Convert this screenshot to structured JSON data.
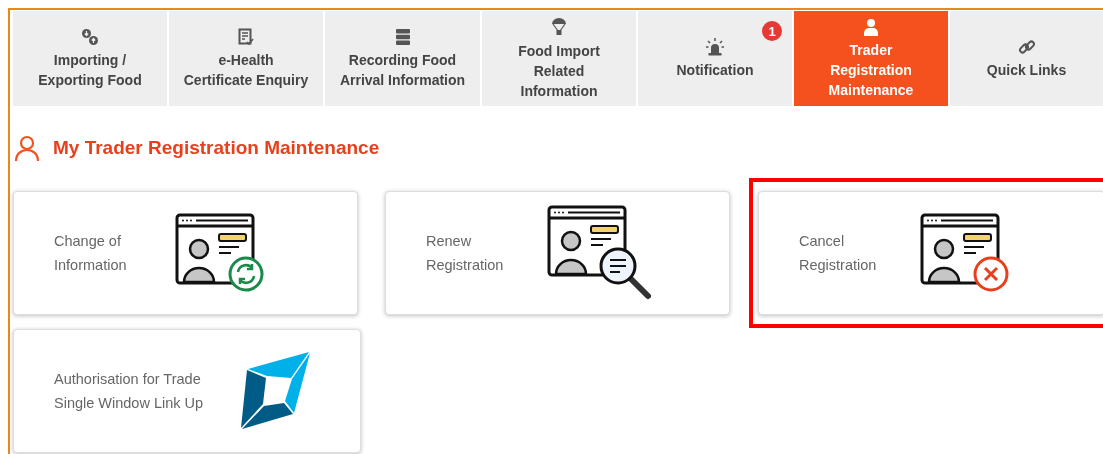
{
  "tabs": [
    {
      "label": "Importing / Exporting Food",
      "kind": "transfer",
      "selected": false
    },
    {
      "label": "e-Health Certificate Enquiry",
      "kind": "document",
      "selected": false
    },
    {
      "label": "Recording Food Arrival Information",
      "kind": "server",
      "selected": false
    },
    {
      "label": "Food Import Related Information",
      "kind": "parachute",
      "selected": false
    },
    {
      "label": "Notification",
      "kind": "alarm",
      "badge": "1",
      "selected": false
    },
    {
      "label": "Trader Registration Maintenance",
      "kind": "person",
      "selected": true
    },
    {
      "label": "Quick Links",
      "kind": "link",
      "selected": false
    }
  ],
  "heading": "My Trader Registration Maintenance",
  "cards": [
    {
      "label": "Change of Information",
      "kind": "refresh",
      "highlighted": false
    },
    {
      "label": "Renew Registration",
      "kind": "search",
      "highlighted": false
    },
    {
      "label": "Cancel Registration",
      "kind": "cancel",
      "highlighted": true
    },
    {
      "label": "Authorisation for Trade Single Window Link Up",
      "kind": "logo",
      "highlighted": false
    }
  ]
}
